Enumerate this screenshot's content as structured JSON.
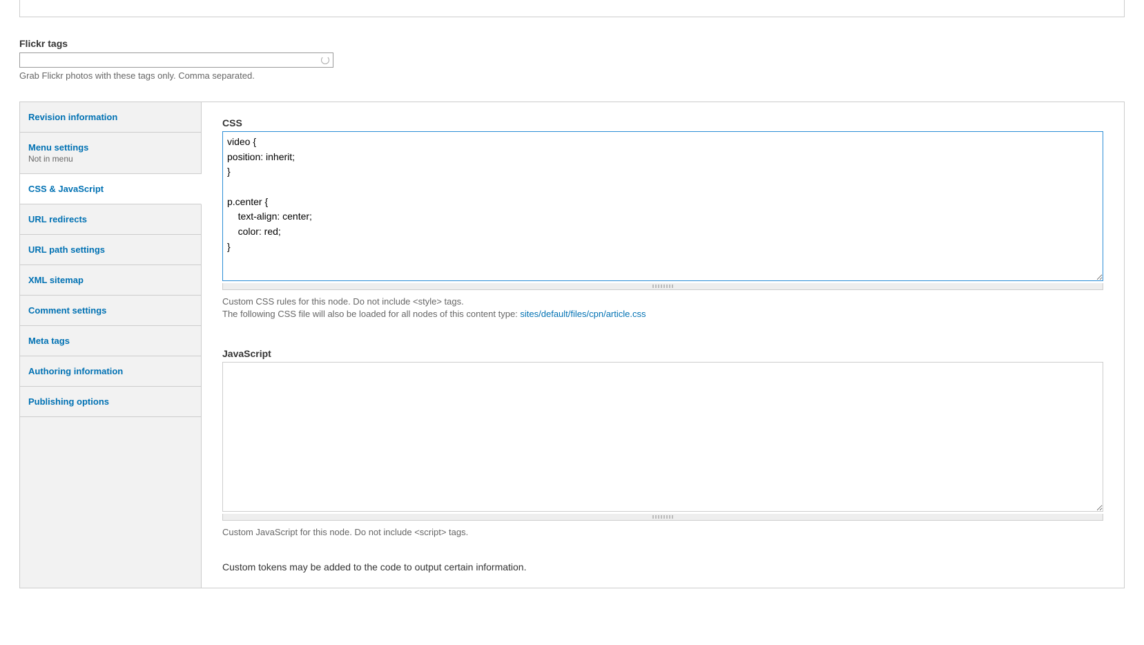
{
  "flickr": {
    "label": "Flickr tags",
    "value": "",
    "help": "Grab Flickr photos with these tags only. Comma separated."
  },
  "tabs": [
    {
      "label": "Revision information",
      "summary": ""
    },
    {
      "label": "Menu settings",
      "summary": "Not in menu"
    },
    {
      "label": "CSS & JavaScript",
      "summary": ""
    },
    {
      "label": "URL redirects",
      "summary": ""
    },
    {
      "label": "URL path settings",
      "summary": ""
    },
    {
      "label": "XML sitemap",
      "summary": ""
    },
    {
      "label": "Comment settings",
      "summary": ""
    },
    {
      "label": "Meta tags",
      "summary": ""
    },
    {
      "label": "Authoring information",
      "summary": ""
    },
    {
      "label": "Publishing options",
      "summary": ""
    }
  ],
  "css_section": {
    "label": "CSS",
    "value": "video {\nposition: inherit;\n}\n\np.center {\n    text-align: center;\n    color: red;\n}",
    "help1": "Custom CSS rules for this node. Do not include <style> tags.",
    "help2_prefix": "The following CSS file will also be loaded for all nodes of this content type: ",
    "help2_link": "sites/default/files/cpn/article.css"
  },
  "js_section": {
    "label": "JavaScript",
    "value": "",
    "help": "Custom JavaScript for this node. Do not include <script> tags."
  },
  "tokens_note": "Custom tokens may be added to the code to output certain information."
}
